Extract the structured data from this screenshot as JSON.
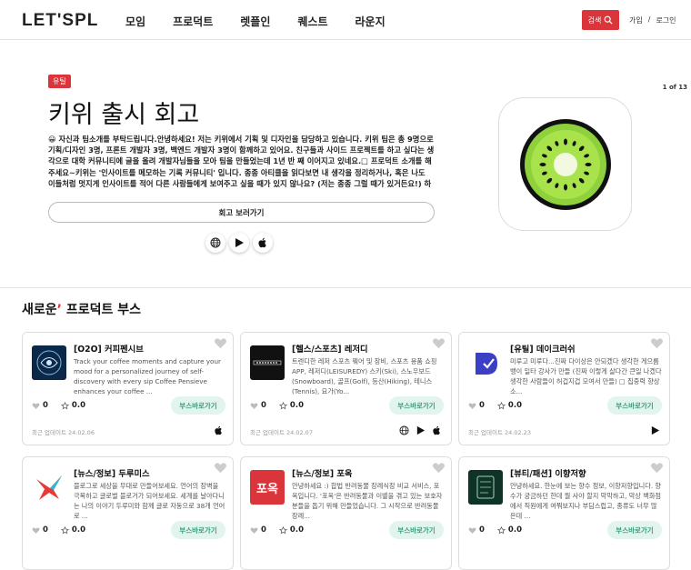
{
  "header": {
    "logo": "LET'SPL",
    "nav": [
      "모임",
      "프로덕트",
      "렛플인",
      "퀘스트",
      "라운지"
    ],
    "search_label": "검색",
    "signup": "가입",
    "separator": "/",
    "login": "로그인"
  },
  "hero": {
    "pager": "1 of 13",
    "tag": "유틸",
    "title": "키위 출시 회고",
    "description": "😀 자신과 팀소개를 부탁드립니다.안녕하세요! 저는 키위에서 기획 및 디자인을 담당하고 있습니다. 키위 팀은 총 9명으로 기획/디자인 3명, 프론트 개발자 3명, 백엔드 개발자 3명이 함께하고 있어요. 친구들과 사이드 프로젝트를 하고 싶다는 생각으로 대학 커뮤니티에 글을 올려 개발자님들을 모아 팀을 만들었는데 1년 반 째 이어지고 있네요.□ 프로덕트 소개를 해주세요~키위는 '인사이트를 메모하는 기록 커뮤니티' 입니다. 종종 아티클을 읽다보면 내 생각을 정리하거나, 혹은 나도 이들처럼 멋지게 인사이트를 적어 다른 사람들에게 보여주고 싶을 때가 있지 않나요? (저는 종종 그럴 때가 있거든요!) 하지만 오랜 시간을 내...",
    "button_label": "회고 보러가기",
    "platforms": [
      "globe-icon",
      "play-store-icon",
      "apple-icon"
    ]
  },
  "section": {
    "title_main": "새로운",
    "title_rest": " 프로덕트 부스"
  },
  "cards": [
    {
      "title": "[O2O] 커피펜시브",
      "desc": "Track your coffee moments and capture your mood for a personalized journey of self-discovery with every sip Coffee Pensieve enhances your coffee ...",
      "likes": "0",
      "rating": "0.0",
      "button": "부스바로가기",
      "updated": "최근 업데이트 24.02.06",
      "platforms": [
        "apple"
      ]
    },
    {
      "title": "[헬스/스포츠] 레저디",
      "desc": "트렌디한 레저 스포츠 웨어 및 장비, 스포츠 용품 쇼핑APP, 레저디(LEISUREDY) 스키(Ski), 스노우보드(Snowboard), 골프(Golf), 등산(Hiking), 테니스(Tennis), 요가(Yo...",
      "likes": "0",
      "rating": "0.0",
      "button": "부스바로가기",
      "updated": "최근 업데이트 24.02.07",
      "platforms": [
        "globe",
        "play",
        "apple"
      ]
    },
    {
      "title": "[유틸] 데이크러쉬",
      "desc": "미루고 미루다...진짜 다이상은 안되겠다 생각한 게으름뱅이 일타 강사가 만들 (진짜 이렇게 살다간 큰일 나겠다 생각한 사람들이 허겁지겁 모여서 만들) □ 집중력 향상 소...",
      "likes": "0",
      "rating": "0.0",
      "button": "부스바로가기",
      "updated": "최근 업데이트 24.02.23",
      "platforms": [
        "play"
      ]
    },
    {
      "title": "[뉴스/정보] 두루미스",
      "desc": "블로그로 세상을 무대로 만들어보세요. 언어의 장벽을 극복하고 글로벌 블로거가 되어보세요. 세계를 날아다니는 나의 이야기 두루미와 함께 글로 자동으로 38개 언어로 ...",
      "likes": "0",
      "rating": "0.0",
      "button": "부스바로가기"
    },
    {
      "title": "[뉴스/정보] 포옥",
      "desc": "안녕하세요 :) 합법 반려동물 장례식장 비교 서비스, 포옥입니다. '포옥'은 반려동물과 이별을 겪고 있는 보호자분들을 돕기 위해 만들었습니다. 그 시작으로 반려동물 장례...",
      "likes": "0",
      "rating": "0.0",
      "button": "부스바로가기"
    },
    {
      "title": "[뷰티/패션] 이향저향",
      "desc": "안녕하세요. 한눈에 보는 향수 정보, 이향저향입니다. 향수가 궁금하던 한데 뭘 사야 할지 막막하고, 막상 백화점에서 직원에게 여쭤보지나 부담스럽고, 종류도 너무 많은데 ...",
      "likes": "0",
      "rating": "0.0",
      "button": "부스바로가기"
    }
  ]
}
